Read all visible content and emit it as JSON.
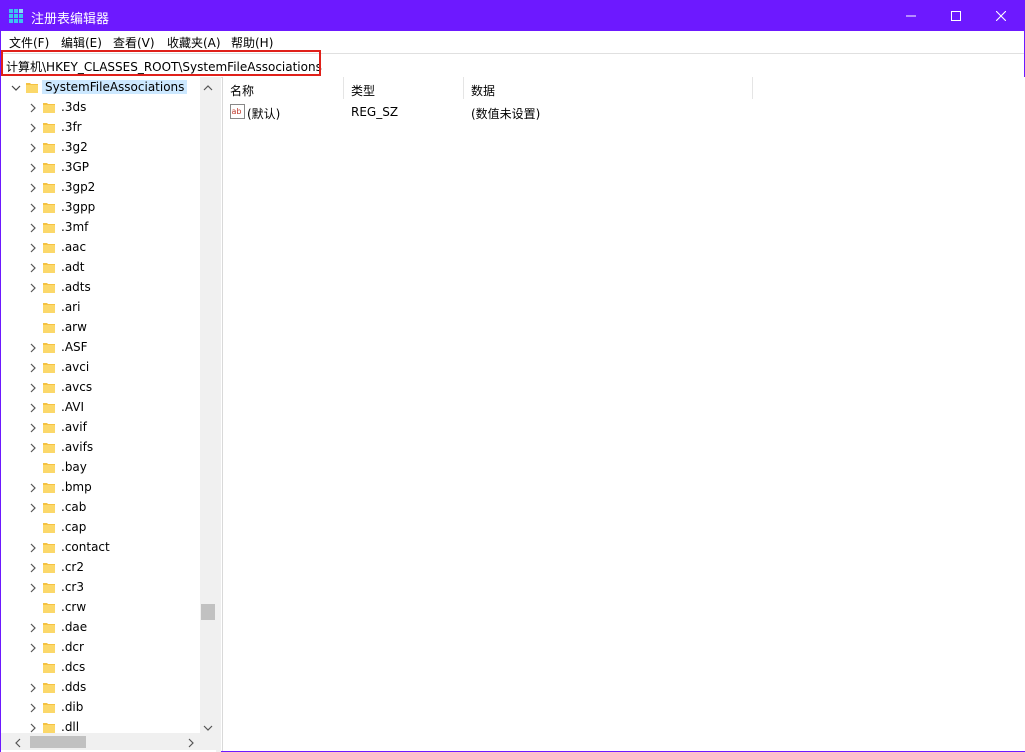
{
  "window": {
    "title": "注册表编辑器",
    "accent_color": "#6d19ff"
  },
  "title_controls": {
    "minimize_icon": "minimize-icon",
    "maximize_icon": "maximize-icon",
    "close_icon": "close-icon"
  },
  "menu": {
    "items": [
      {
        "label": "文件(F)"
      },
      {
        "label": "编辑(E)"
      },
      {
        "label": "查看(V)"
      },
      {
        "label": "收藏夹(A)"
      },
      {
        "label": "帮助(H)"
      }
    ]
  },
  "address": {
    "path": "计算机\\HKEY_CLASSES_ROOT\\SystemFileAssociations",
    "highlight_color": "#e0201a"
  },
  "tree": {
    "root": {
      "label": "SystemFileAssociations",
      "expanded": true
    },
    "children": [
      {
        "label": ".3ds",
        "expandable": true
      },
      {
        "label": ".3fr",
        "expandable": true
      },
      {
        "label": ".3g2",
        "expandable": true
      },
      {
        "label": ".3GP",
        "expandable": true
      },
      {
        "label": ".3gp2",
        "expandable": true
      },
      {
        "label": ".3gpp",
        "expandable": true
      },
      {
        "label": ".3mf",
        "expandable": true
      },
      {
        "label": ".aac",
        "expandable": true
      },
      {
        "label": ".adt",
        "expandable": true
      },
      {
        "label": ".adts",
        "expandable": true
      },
      {
        "label": ".ari",
        "expandable": false
      },
      {
        "label": ".arw",
        "expandable": false
      },
      {
        "label": ".ASF",
        "expandable": true
      },
      {
        "label": ".avci",
        "expandable": true
      },
      {
        "label": ".avcs",
        "expandable": true
      },
      {
        "label": ".AVI",
        "expandable": true
      },
      {
        "label": ".avif",
        "expandable": true
      },
      {
        "label": ".avifs",
        "expandable": true
      },
      {
        "label": ".bay",
        "expandable": false
      },
      {
        "label": ".bmp",
        "expandable": true
      },
      {
        "label": ".cab",
        "expandable": true
      },
      {
        "label": ".cap",
        "expandable": false
      },
      {
        "label": ".contact",
        "expandable": true
      },
      {
        "label": ".cr2",
        "expandable": true
      },
      {
        "label": ".cr3",
        "expandable": true
      },
      {
        "label": ".crw",
        "expandable": false
      },
      {
        "label": ".dae",
        "expandable": true
      },
      {
        "label": ".dcr",
        "expandable": true
      },
      {
        "label": ".dcs",
        "expandable": false
      },
      {
        "label": ".dds",
        "expandable": true
      },
      {
        "label": ".dib",
        "expandable": true
      },
      {
        "label": ".dll",
        "expandable": true
      }
    ]
  },
  "list": {
    "columns": [
      {
        "label": "名称"
      },
      {
        "label": "类型"
      },
      {
        "label": "数据"
      }
    ],
    "rows": [
      {
        "name": "(默认)",
        "type": "REG_SZ",
        "data": "(数值未设置)",
        "icon": "string-value-icon"
      }
    ]
  }
}
